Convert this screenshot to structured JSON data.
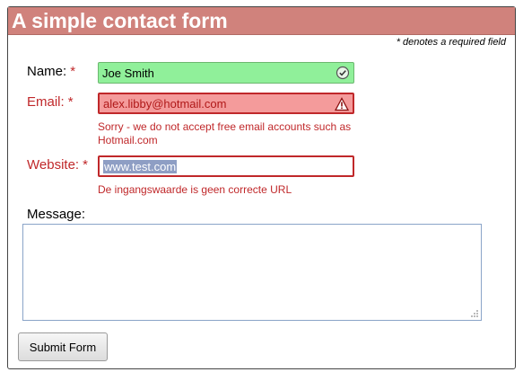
{
  "form": {
    "title": "A simple contact form",
    "required_note": "* denotes a required field",
    "name": {
      "label": "Name:",
      "required_mark": "*",
      "value": "Joe Smith",
      "status": "valid"
    },
    "email": {
      "label": "Email:",
      "required_mark": "*",
      "value": "alex.libby@hotmail.com",
      "status": "invalid",
      "error_line1": "Sorry - we do not accept free email accounts such as",
      "error_line2": "Hotmail.com"
    },
    "website": {
      "label": "Website:",
      "required_mark": "*",
      "value": "www.test.com",
      "status": "invalid",
      "error": "De ingangswaarde is geen correcte URL"
    },
    "message": {
      "label": "Message:",
      "value": ""
    },
    "submit_label": "Submit Form"
  },
  "colors": {
    "title_bar": "#d0827c",
    "valid_bg": "#90f09a",
    "invalid_bg": "#f49b9b",
    "error_text": "#c0282a"
  },
  "icons": {
    "name_status": "checkmark-circle-icon",
    "email_status": "warning-triangle-icon",
    "textarea_grip": "resize-grip-icon"
  }
}
